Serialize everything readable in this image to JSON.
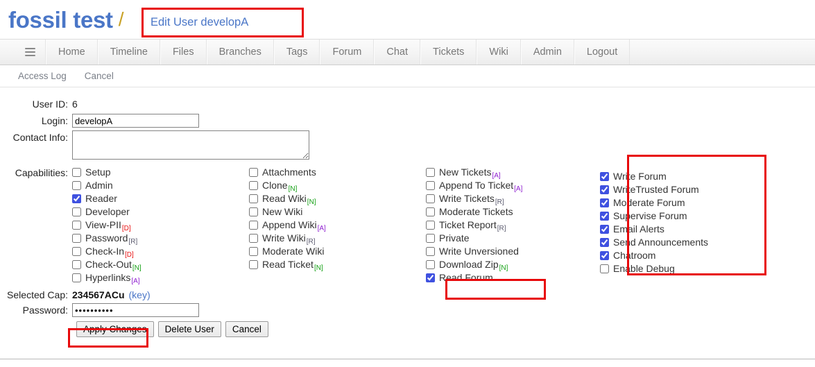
{
  "header": {
    "project_title": "fossil test",
    "separator": "/",
    "page_subtitle": "Edit User developA"
  },
  "mainmenu": {
    "hamburger_icon": "hamburger-menu-icon",
    "items": [
      {
        "label": "Home"
      },
      {
        "label": "Timeline"
      },
      {
        "label": "Files"
      },
      {
        "label": "Branches"
      },
      {
        "label": "Tags"
      },
      {
        "label": "Forum"
      },
      {
        "label": "Chat"
      },
      {
        "label": "Tickets"
      },
      {
        "label": "Wiki"
      },
      {
        "label": "Admin"
      },
      {
        "label": "Logout"
      }
    ]
  },
  "submenu": {
    "items": [
      {
        "label": "Access Log"
      },
      {
        "label": "Cancel"
      }
    ]
  },
  "form": {
    "user_id_label": "User ID:",
    "user_id_value": "6",
    "login_label": "Login:",
    "login_value": "developA",
    "contact_label": "Contact Info:",
    "contact_value": "",
    "capabilities_label": "Capabilities:",
    "selected_cap_label": "Selected Cap:",
    "selected_cap_value": "234567ACu",
    "selected_cap_key_link": "(key)",
    "password_label": "Password:",
    "password_value": "••••••••••"
  },
  "capabilities": {
    "col1": [
      {
        "label": "Setup",
        "checked": false,
        "sub": "",
        "subclass": ""
      },
      {
        "label": "Admin",
        "checked": false,
        "sub": "",
        "subclass": ""
      },
      {
        "label": "Reader",
        "checked": true,
        "sub": "",
        "subclass": ""
      },
      {
        "label": "Developer",
        "checked": false,
        "sub": "",
        "subclass": ""
      },
      {
        "label": "View-PII",
        "checked": false,
        "sub": "[D]",
        "subclass": "d"
      },
      {
        "label": "Password",
        "checked": false,
        "sub": "[R]",
        "subclass": "r"
      },
      {
        "label": "Check-In",
        "checked": false,
        "sub": "[D]",
        "subclass": "d"
      },
      {
        "label": "Check-Out",
        "checked": false,
        "sub": "[N]",
        "subclass": "n"
      },
      {
        "label": "Hyperlinks",
        "checked": false,
        "sub": "[A]",
        "subclass": "a"
      }
    ],
    "col2": [
      {
        "label": "Attachments",
        "checked": false,
        "sub": "",
        "subclass": ""
      },
      {
        "label": "Clone",
        "checked": false,
        "sub": "[N]",
        "subclass": "n"
      },
      {
        "label": "Read Wiki",
        "checked": false,
        "sub": "[N]",
        "subclass": "n"
      },
      {
        "label": "New Wiki",
        "checked": false,
        "sub": "",
        "subclass": ""
      },
      {
        "label": "Append Wiki",
        "checked": false,
        "sub": "[A]",
        "subclass": "a"
      },
      {
        "label": "Write Wiki",
        "checked": false,
        "sub": "[R]",
        "subclass": "r"
      },
      {
        "label": "Moderate Wiki",
        "checked": false,
        "sub": "",
        "subclass": ""
      },
      {
        "label": "Read Ticket",
        "checked": false,
        "sub": "[N]",
        "subclass": "n"
      }
    ],
    "col3": [
      {
        "label": "New Tickets",
        "checked": false,
        "sub": "[A]",
        "subclass": "a"
      },
      {
        "label": "Append To Ticket",
        "checked": false,
        "sub": "[A]",
        "subclass": "a"
      },
      {
        "label": "Write Tickets",
        "checked": false,
        "sub": "[R]",
        "subclass": "r"
      },
      {
        "label": "Moderate Tickets",
        "checked": false,
        "sub": "",
        "subclass": ""
      },
      {
        "label": "Ticket Report",
        "checked": false,
        "sub": "[R]",
        "subclass": "r"
      },
      {
        "label": "Private",
        "checked": false,
        "sub": "",
        "subclass": ""
      },
      {
        "label": "Write Unversioned",
        "checked": false,
        "sub": "",
        "subclass": ""
      },
      {
        "label": "Download Zip",
        "checked": false,
        "sub": "[N]",
        "subclass": "n"
      },
      {
        "label": "Read Forum",
        "checked": true,
        "sub": "",
        "subclass": ""
      }
    ],
    "col4": [
      {
        "label": "Write Forum",
        "checked": true,
        "sub": "",
        "subclass": ""
      },
      {
        "label": "WriteTrusted Forum",
        "checked": true,
        "sub": "",
        "subclass": ""
      },
      {
        "label": "Moderate Forum",
        "checked": true,
        "sub": "",
        "subclass": ""
      },
      {
        "label": "Supervise Forum",
        "checked": true,
        "sub": "",
        "subclass": ""
      },
      {
        "label": "Email Alerts",
        "checked": true,
        "sub": "",
        "subclass": ""
      },
      {
        "label": "Send Announcements",
        "checked": true,
        "sub": "",
        "subclass": ""
      },
      {
        "label": "Chatroom",
        "checked": true,
        "sub": "",
        "subclass": ""
      },
      {
        "label": "Enable Debug",
        "checked": false,
        "sub": "",
        "subclass": ""
      }
    ]
  },
  "buttons": {
    "apply": "Apply Changes",
    "delete": "Delete User",
    "cancel": "Cancel"
  },
  "colors": {
    "link_blue": "#4a76c7",
    "highlight_red": "#e8090b",
    "checkbox_blue": "#3f51e0",
    "sub_d_red": "#e81010",
    "sub_n_green": "#14a014",
    "sub_a_purple": "#8f1fd0",
    "sub_r_gray": "#5a5a6e"
  }
}
